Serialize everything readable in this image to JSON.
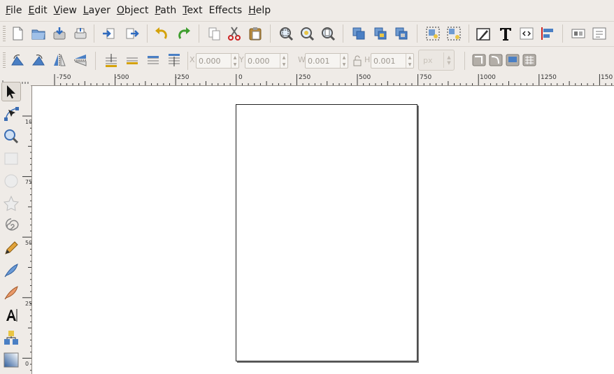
{
  "menu": [
    {
      "label": "File",
      "mnemonic": "F",
      "rest": "ile"
    },
    {
      "label": "Edit",
      "mnemonic": "E",
      "rest": "dit"
    },
    {
      "label": "View",
      "mnemonic": "V",
      "rest": "iew"
    },
    {
      "label": "Layer",
      "mnemonic": "L",
      "rest": "ayer"
    },
    {
      "label": "Object",
      "mnemonic": "O",
      "rest": "bject"
    },
    {
      "label": "Path",
      "mnemonic": "P",
      "rest": "ath"
    },
    {
      "label": "Text",
      "mnemonic": "T",
      "rest": "ext"
    },
    {
      "label": "Effects",
      "mnemonic": "",
      "rest": "Effects"
    },
    {
      "label": "Help",
      "mnemonic": "H",
      "rest": "elp"
    }
  ],
  "controls": {
    "x_label": "X",
    "x_value": "0.000",
    "y_label": "Y",
    "y_value": "0.000",
    "w_label": "W",
    "w_value": "0.001",
    "h_label": "H",
    "h_value": "0.001",
    "unit": "px"
  },
  "ruler": {
    "h_ticks": [
      "-750",
      "-500",
      "-250",
      "0",
      "250",
      "500",
      "750",
      "1000",
      "1250",
      "150"
    ],
    "v_ticks": [
      "1000",
      "750",
      "500",
      "250",
      "0"
    ]
  },
  "colors": {
    "accent": "#3b6db3",
    "background": "#efebe7",
    "canvas": "#ffffff"
  }
}
